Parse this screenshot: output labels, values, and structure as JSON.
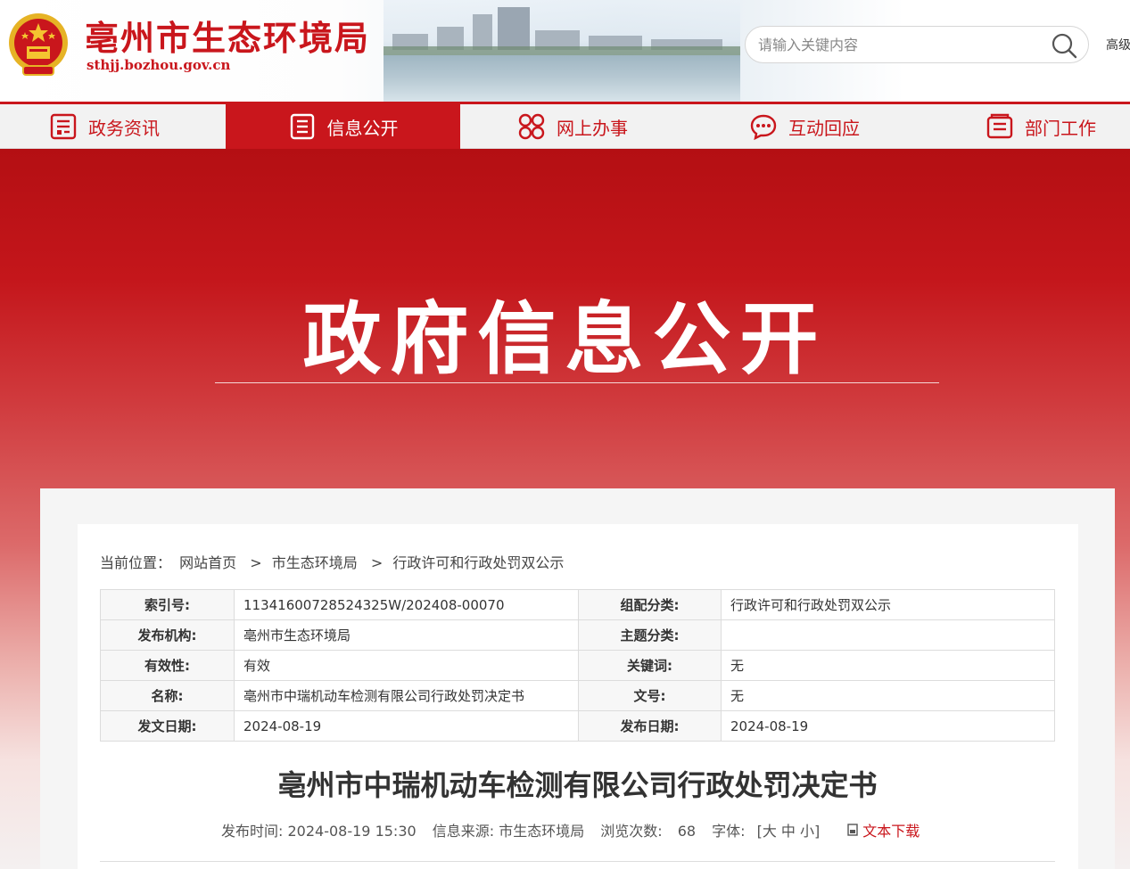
{
  "header": {
    "site_title": "亳州市生态环境局",
    "site_domain": "sthjj.bozhou.gov.cn",
    "search_placeholder": "请输入关键内容",
    "advanced_label": "高级"
  },
  "nav": {
    "items": [
      {
        "label": "政务资讯",
        "icon": "news-list-icon",
        "active": false
      },
      {
        "label": "信息公开",
        "icon": "document-list-icon",
        "active": true
      },
      {
        "label": "网上办事",
        "icon": "apps-grid-icon",
        "active": false
      },
      {
        "label": "互动回应",
        "icon": "chat-bubble-icon",
        "active": false
      },
      {
        "label": "部门工作",
        "icon": "folder-doc-icon",
        "active": false
      }
    ]
  },
  "banner": {
    "title": "政府信息公开"
  },
  "breadcrumb": {
    "prefix": "当前位置：",
    "items": [
      "网站首页",
      "市生态环境局",
      "行政许可和行政处罚双公示"
    ],
    "separator": ">"
  },
  "meta": {
    "rows": [
      {
        "k1": "索引号:",
        "v1": "11341600728524325W/202408-00070",
        "k2": "组配分类:",
        "v2": "行政许可和行政处罚双公示"
      },
      {
        "k1": "发布机构:",
        "v1": "亳州市生态环境局",
        "k2": "主题分类:",
        "v2": ""
      },
      {
        "k1": "有效性:",
        "v1": "有效",
        "k2": "关键词:",
        "v2": "无"
      },
      {
        "k1": "名称:",
        "v1": "亳州市中瑞机动车检测有限公司行政处罚决定书",
        "k2": "文号:",
        "v2": "无"
      },
      {
        "k1": "发文日期:",
        "v1": "2024-08-19",
        "k2": "发布日期:",
        "v2": "2024-08-19"
      }
    ]
  },
  "document": {
    "title": "亳州市中瑞机动车检测有限公司行政处罚决定书",
    "publish_label": "发布时间:",
    "publish_time": "2024-08-19 15:30",
    "source_label": "信息来源:",
    "source": "市生态环境局",
    "views_label": "浏览次数:",
    "views": "68",
    "font_label": "字体:",
    "font_open": "[",
    "font_large": "大",
    "font_medium": "中",
    "font_small": "小",
    "font_close": "]",
    "download_label": "文本下载"
  },
  "colors": {
    "brand_red": "#c9161c"
  }
}
